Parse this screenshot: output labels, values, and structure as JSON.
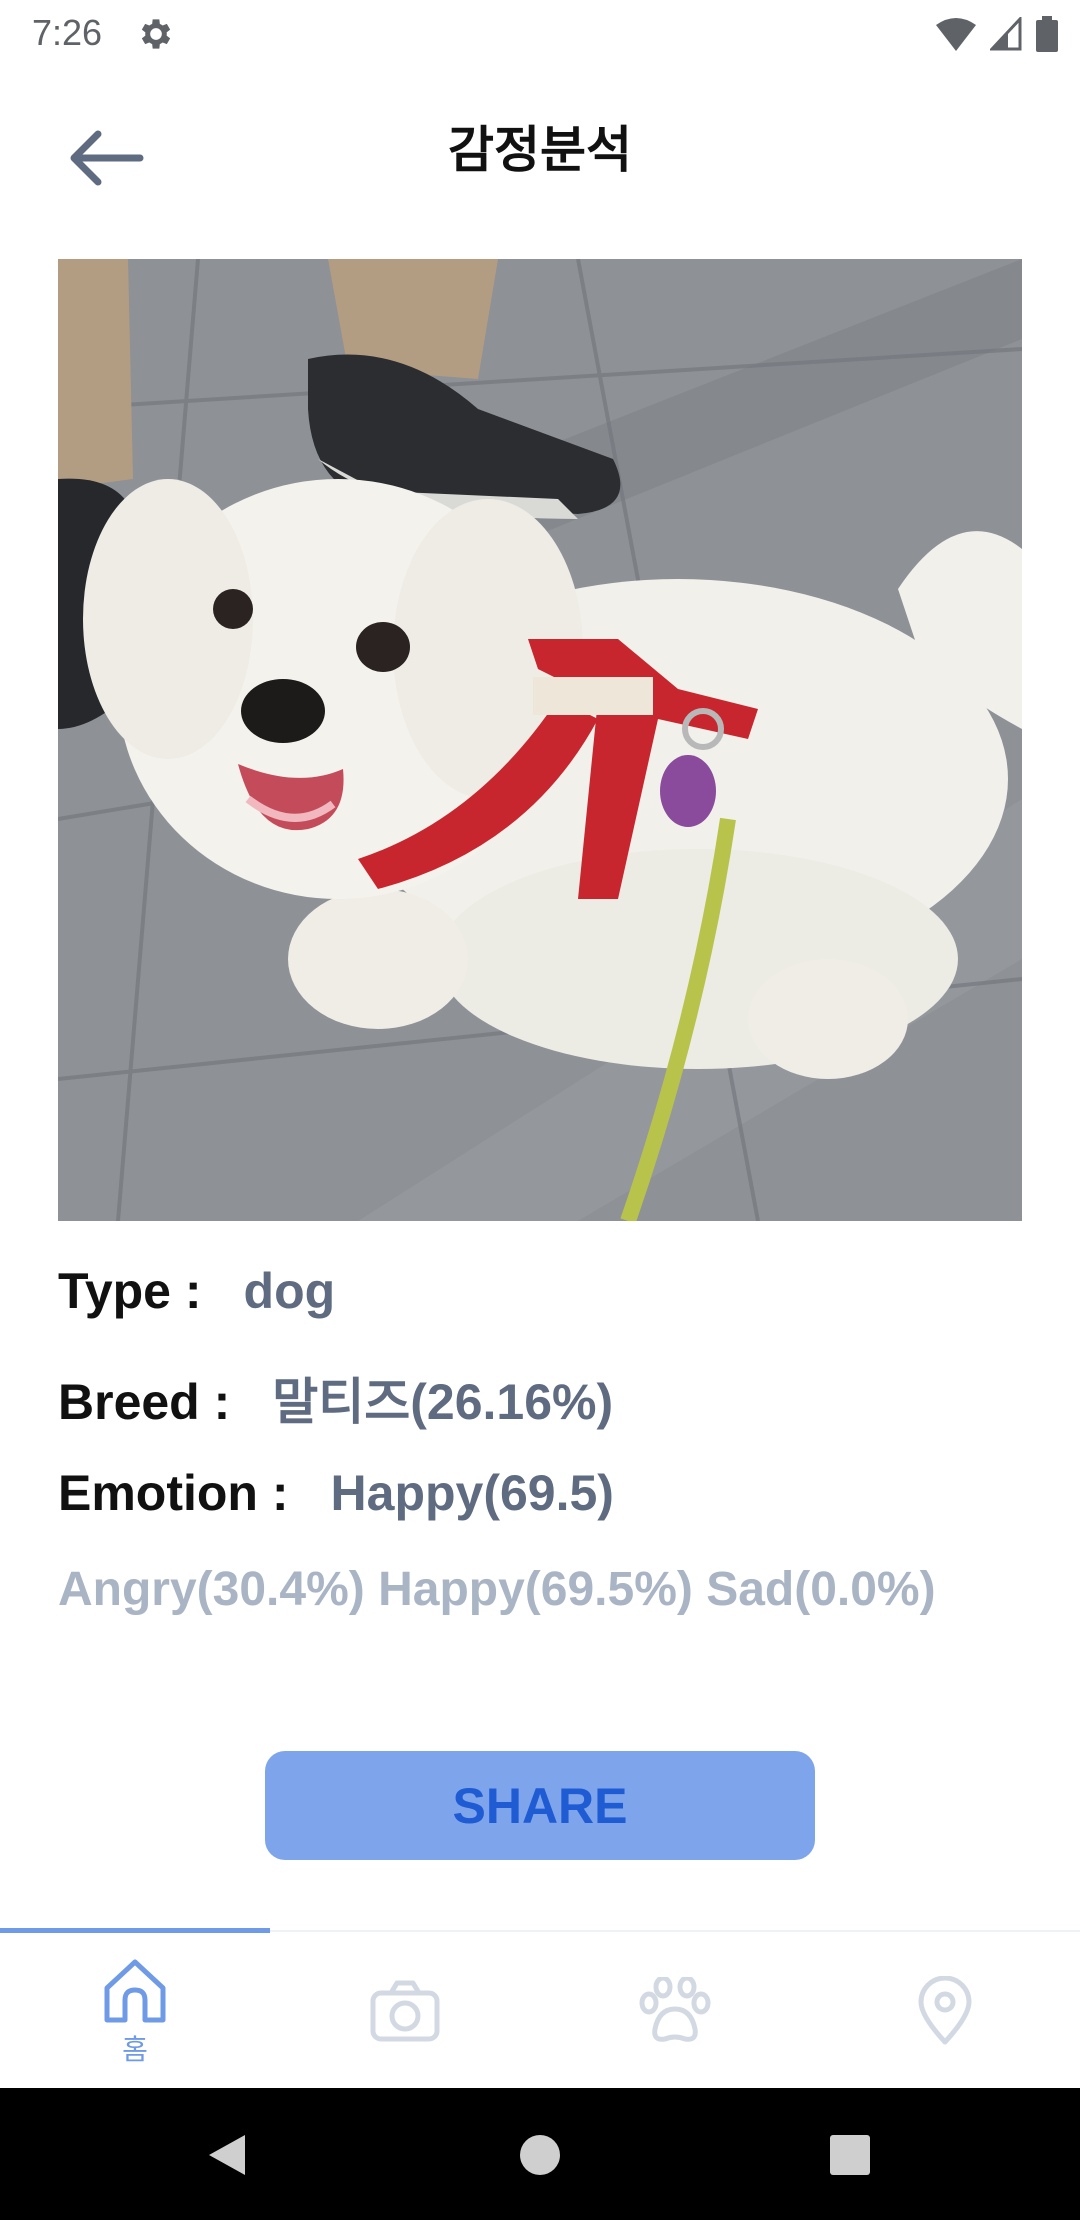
{
  "status_bar": {
    "time": "7:26"
  },
  "header": {
    "title": "감정분석"
  },
  "result": {
    "type_label": "Type :",
    "type_value": "dog",
    "breed_label": "Breed :",
    "breed_value": "말티즈(26.16%)",
    "emotion_label": "Emotion :",
    "emotion_value": "Happy(69.5)",
    "probabilities": "Angry(30.4%) Happy(69.5%) Sad(0.0%)"
  },
  "share_button": {
    "label": "SHARE"
  },
  "tabs": [
    {
      "icon": "home-icon",
      "label": "홈",
      "active": true
    },
    {
      "icon": "camera-icon",
      "label": "",
      "active": false
    },
    {
      "icon": "paw-icon",
      "label": "",
      "active": false
    },
    {
      "icon": "location-pin-icon",
      "label": "",
      "active": false
    }
  ],
  "colors": {
    "accent": "#6f9ae6",
    "share_bg": "#7ea4ec",
    "share_text": "#1f5bd3",
    "value_text": "#5f6b80",
    "muted_text": "#a9b4c4",
    "inactive_icon": "#d3d9e2"
  }
}
